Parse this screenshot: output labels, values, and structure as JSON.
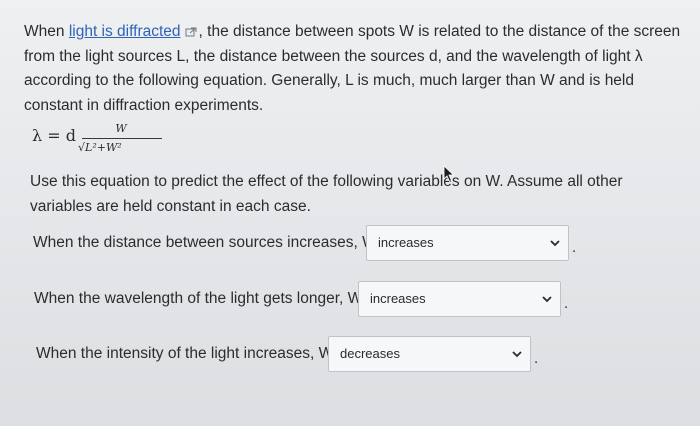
{
  "intro": {
    "before_link": "When ",
    "link_text": "light is diffracted",
    "after_link": ", the distance between spots W is related to the distance of the screen from the light sources L, the distance between the sources d, and the wavelength of light λ according to the following equation. Generally, L is much, much larger than W and is held constant in diffraction experiments."
  },
  "equation": {
    "lhs": "λ = d",
    "numerator": "W",
    "denominator": "√L²+W²"
  },
  "instruction": "Use this equation to predict the effect of the following variables on W. Assume all other variables are held constant in each case.",
  "questions": [
    {
      "prompt": "When the distance between sources increases, W",
      "selected": "increases",
      "suffix": "."
    },
    {
      "prompt": "When the wavelength of the light gets longer, W",
      "selected": "increases",
      "suffix": "."
    },
    {
      "prompt": "When the intensity of the light increases, W",
      "selected": "decreases",
      "suffix": "."
    }
  ],
  "icons": {
    "external_link": "external-link-icon",
    "dropdown": "chevron-down-icon",
    "cursor": "mouse-pointer-icon"
  },
  "colors": {
    "link": "#2f63b5",
    "text": "#2c2c2c",
    "select_border": "#bfc3c7"
  }
}
